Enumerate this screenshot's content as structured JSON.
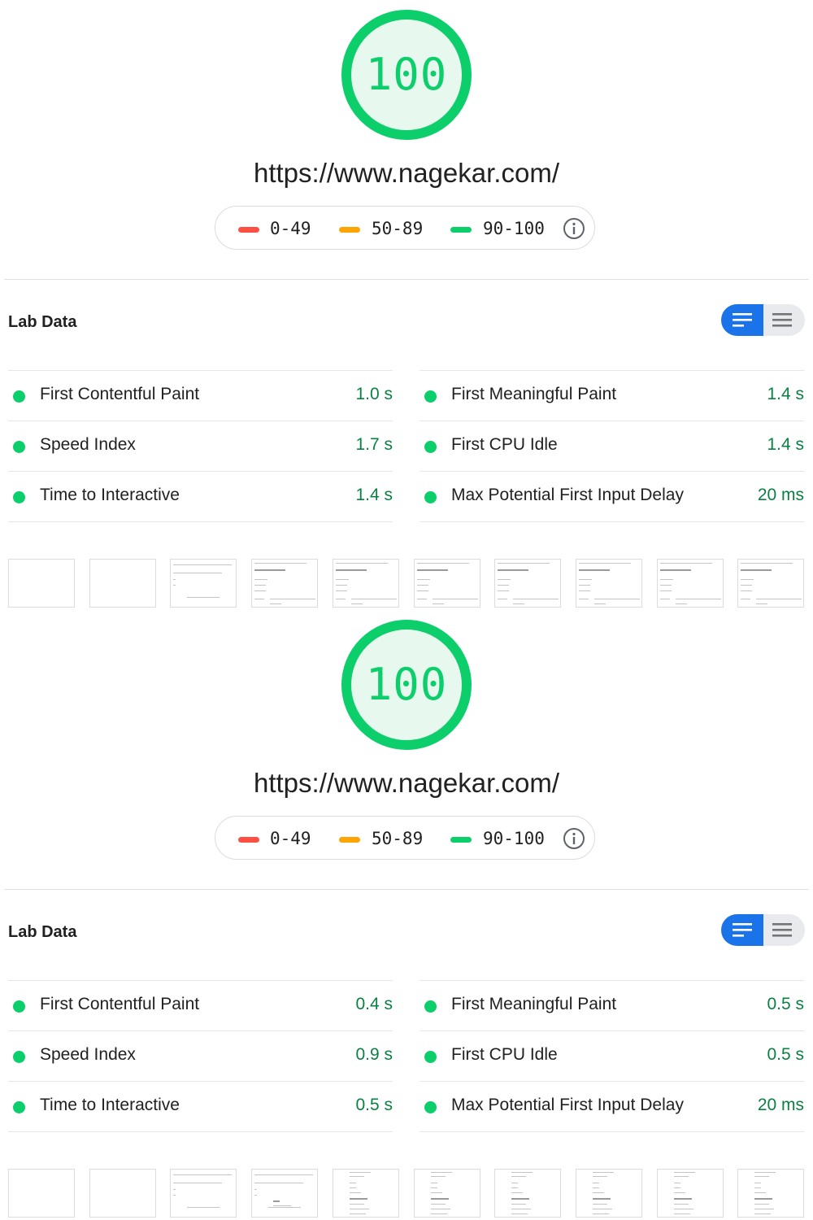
{
  "colors": {
    "pass": "#0cce6b",
    "pass_text": "#0b8043",
    "average": "#ffa400",
    "fail": "#ff4e42",
    "toggle_active": "#1a73e8"
  },
  "reports": [
    {
      "score": "100",
      "url": "https://www.nagekar.com/",
      "legend": [
        {
          "label": "0-49",
          "level": "fail"
        },
        {
          "label": "50-89",
          "level": "average"
        },
        {
          "label": "90-100",
          "level": "pass"
        }
      ],
      "info_icon": "info-icon",
      "section_title": "Lab Data",
      "toggle": {
        "selected": "summary-view",
        "options": [
          "summary-view-icon",
          "list-view-icon"
        ]
      },
      "metrics": [
        {
          "label": "First Contentful Paint",
          "value": "1.0 s",
          "status": "pass"
        },
        {
          "label": "First Meaningful Paint",
          "value": "1.4 s",
          "status": "pass"
        },
        {
          "label": "Speed Index",
          "value": "1.7 s",
          "status": "pass"
        },
        {
          "label": "First CPU Idle",
          "value": "1.4 s",
          "status": "pass"
        },
        {
          "label": "Time to Interactive",
          "value": "1.4 s",
          "status": "pass"
        },
        {
          "label": "Max Potential First Input Delay",
          "value": "20 ms",
          "status": "pass"
        }
      ],
      "filmstrip_frames": [
        "blank",
        "blank",
        "partial",
        "full",
        "full",
        "full",
        "full",
        "full",
        "full",
        "full"
      ]
    },
    {
      "score": "100",
      "url": "https://www.nagekar.com/",
      "legend": [
        {
          "label": "0-49",
          "level": "fail"
        },
        {
          "label": "50-89",
          "level": "average"
        },
        {
          "label": "90-100",
          "level": "pass"
        }
      ],
      "info_icon": "info-icon",
      "section_title": "Lab Data",
      "toggle": {
        "selected": "summary-view",
        "options": [
          "summary-view-icon",
          "list-view-icon"
        ]
      },
      "metrics": [
        {
          "label": "First Contentful Paint",
          "value": "0.4 s",
          "status": "pass"
        },
        {
          "label": "First Meaningful Paint",
          "value": "0.5 s",
          "status": "pass"
        },
        {
          "label": "Speed Index",
          "value": "0.9 s",
          "status": "pass"
        },
        {
          "label": "First CPU Idle",
          "value": "0.5 s",
          "status": "pass"
        },
        {
          "label": "Time to Interactive",
          "value": "0.5 s",
          "status": "pass"
        },
        {
          "label": "Max Potential First Input Delay",
          "value": "20 ms",
          "status": "pass"
        }
      ],
      "filmstrip_frames": [
        "blank",
        "blank",
        "partial",
        "partial",
        "mobile",
        "mobile",
        "mobile",
        "mobile",
        "mobile",
        "mobile"
      ]
    }
  ]
}
